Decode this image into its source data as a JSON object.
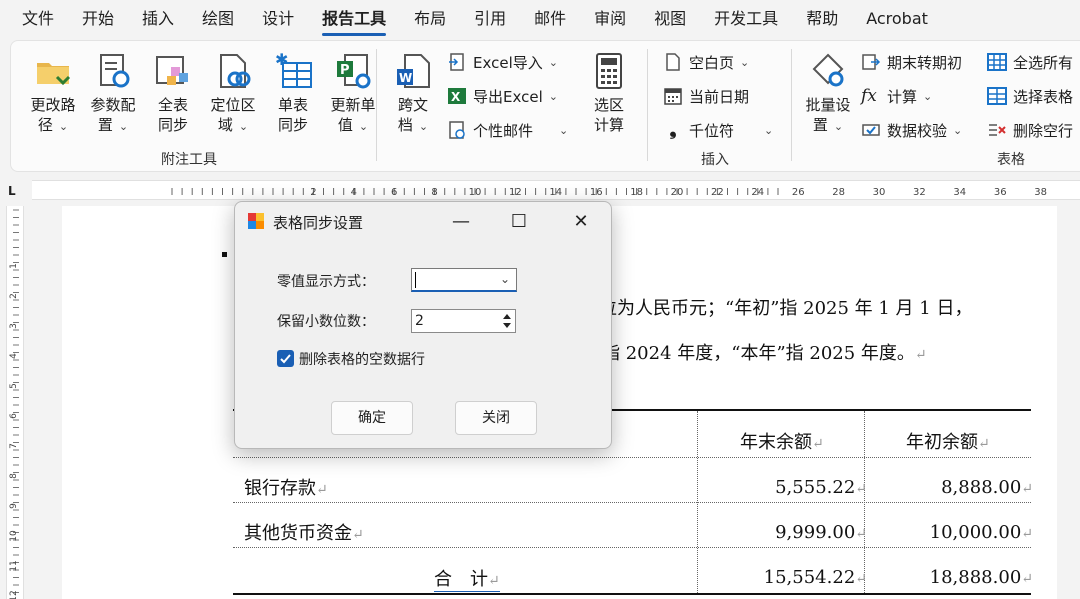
{
  "menu_tabs": [
    {
      "label": "文件"
    },
    {
      "label": "开始"
    },
    {
      "label": "插入"
    },
    {
      "label": "绘图"
    },
    {
      "label": "设计"
    },
    {
      "label": "报告工具"
    },
    {
      "label": "布局"
    },
    {
      "label": "引用"
    },
    {
      "label": "邮件"
    },
    {
      "label": "审阅"
    },
    {
      "label": "视图"
    },
    {
      "label": "开发工具"
    },
    {
      "label": "帮助"
    },
    {
      "label": "Acrobat"
    }
  ],
  "active_tab": "报告工具",
  "ribbon": {
    "group1": {
      "label": "附注工具",
      "buttons": [
        {
          "line1": "更改路",
          "line2": "径",
          "icon": "folder-path-icon"
        },
        {
          "line1": "参数配",
          "line2": "置",
          "icon": "settings-doc-icon"
        },
        {
          "line1": "全表",
          "line2": "同步",
          "icon": "table-sync-all-icon"
        },
        {
          "line1": "定位区",
          "line2": "域",
          "icon": "locate-region-icon"
        },
        {
          "line1": "单表",
          "line2": "同步",
          "icon": "table-sync-single-icon"
        },
        {
          "line1": "更新单",
          "line2": "值",
          "icon": "update-value-icon"
        }
      ]
    },
    "group2": {
      "label": "插入",
      "cross_doc": {
        "line1": "跨文",
        "line2": "档",
        "icon": "word-cross-doc-icon"
      },
      "excel_import": "Excel导入",
      "export_excel": "导出Excel",
      "mail_merge": "个性邮件",
      "calc": {
        "line1": "选区",
        "line2": "计算",
        "icon": "calculator-icon"
      },
      "blank_page": "空白页",
      "current_date": "当前日期",
      "thousands": "千位符"
    },
    "group3": {
      "label": "表格",
      "batch": {
        "line1": "批量设",
        "line2": "置",
        "icon": "batch-settings-icon"
      },
      "period_convert": "期末转期初",
      "calculate": "计算",
      "data_validate": "数据校验",
      "select_all": "全选所有",
      "select_table": "选择表格",
      "delete_blank": "删除空行"
    }
  },
  "ruler_labels": [
    "2",
    "4",
    "6",
    "8",
    "10",
    "12",
    "14",
    "16",
    "18",
    "20",
    "22",
    "24",
    "26",
    "28",
    "30",
    "32",
    "34",
    "36",
    "38"
  ],
  "vruler_labels": [
    "1",
    "2",
    "3",
    "4",
    "5",
    "6",
    "7",
    "8",
    "9",
    "10",
    "11",
    "12"
  ],
  "document": {
    "line1": "位为人民币元；“年初”指 2025 年 1 月 1 日，",
    "line2": "指 2024 年度，“本年”指 2025 年度。",
    "table": {
      "headers": [
        "年末余额",
        "年初余额"
      ],
      "rows": [
        {
          "label": "银行存款",
          "end": "5,555.22",
          "begin": "8,888.00"
        },
        {
          "label": "其他货币资金",
          "end": "9,999.00",
          "begin": "10,000.00"
        },
        {
          "label": "合　计",
          "end": "15,554.22",
          "begin": "18,888.00"
        }
      ]
    }
  },
  "dialog": {
    "title": "表格同步设置",
    "zero_display_label": "零值显示方式：",
    "zero_display_value": "",
    "decimals_label": "保留小数位数：",
    "decimals_value": "2",
    "delete_blank_rows_label": "删除表格的空数据行",
    "delete_blank_rows_checked": true,
    "ok_label": "确定",
    "close_label": "关闭"
  }
}
